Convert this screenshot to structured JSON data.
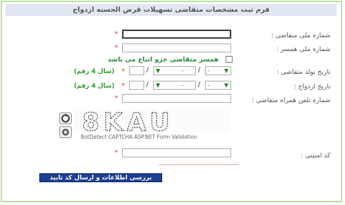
{
  "form": {
    "title": "فرم ثبت مشخصات متقاضی تسهیلات قرض الحسنه ازدواج",
    "required_mark": "*",
    "fields": {
      "applicant_national_id": {
        "label": "شماره ملی متقاضی :",
        "value": ""
      },
      "spouse_national_id": {
        "label": "شماره ملی همسر :",
        "value": ""
      },
      "spouse_dependent": {
        "label": "همسر متقاضی جزو اتباع می باشد",
        "checked": false
      },
      "birth_date": {
        "label": "تاریخ تولد متقاضی :",
        "day": "-",
        "month": "-",
        "year": "",
        "hint": "(سال 4 رقم)"
      },
      "marriage_date": {
        "label": "تاریخ ازدواج :",
        "day": "-",
        "month": "-",
        "year": "",
        "hint": "(سال 4 رقم)"
      },
      "mobile": {
        "label": "شماره تلفن همراه متقاضی :",
        "value": ""
      },
      "security_code": {
        "label": "کد امنیتی :",
        "value": ""
      }
    },
    "captcha": {
      "text": "8KAU",
      "caption": "BotDetect CAPTCHA ASP.NET Form Validation",
      "reload_icon": "reload-icon",
      "sound_icon": "sound-icon"
    },
    "submit_label": "بررسی اطلاعات و ارسال کد تایید",
    "slash": "/",
    "colors": {
      "border": "#b8e39a",
      "title_bg": "#e1e7f1",
      "button": "#1c3f94",
      "hint": "#2e9a2e",
      "required": "#e03030"
    }
  }
}
